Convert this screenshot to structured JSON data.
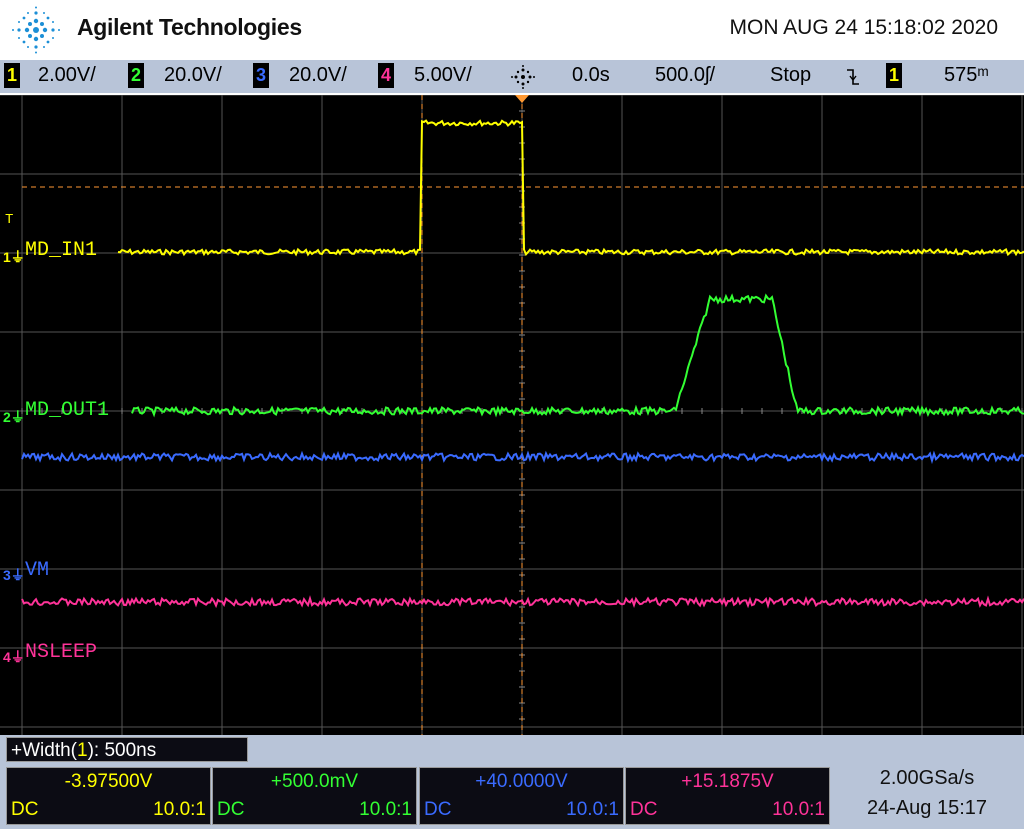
{
  "header": {
    "brand": "Agilent Technologies",
    "datetime": "MON AUG 24 15:18:02 2020"
  },
  "status_bar": {
    "ch1": {
      "num": "1",
      "scale": "2.00V/",
      "color": "#ffff00"
    },
    "ch2": {
      "num": "2",
      "scale": "20.0V/",
      "color": "#33ff33"
    },
    "ch3": {
      "num": "3",
      "scale": "20.0V/",
      "color": "#3a6bff"
    },
    "ch4": {
      "num": "4",
      "scale": "5.00V/",
      "color": "#ff3399"
    },
    "trigger_position": "0.0s",
    "timebase": "500.0ʃ/",
    "run_state": "Stop",
    "trigger_slope_icon": "falling-edge-icon",
    "trigger_source": "1",
    "trigger_level": "575ᵐ"
  },
  "channels": {
    "ch1_label": "MD_IN1",
    "ch2_label": "MD_OUT1",
    "ch3_label": "VM",
    "ch4_label": "NSLEEP",
    "trigger_marker": "T"
  },
  "measurement": {
    "label_pre": "+Width(",
    "label_ch": "1",
    "label_post": "): 500ns"
  },
  "bottom": {
    "ch1": {
      "value": "-3.97500V",
      "coupling": "DC",
      "probe": "10.0:1"
    },
    "ch2": {
      "value": "+500.0mV",
      "coupling": "DC",
      "probe": "10.0:1"
    },
    "ch3": {
      "value": "+40.0000V",
      "coupling": "DC",
      "probe": "10.0:1"
    },
    "ch4": {
      "value": "+15.1875V",
      "coupling": "DC",
      "probe": "10.0:1"
    },
    "sample_rate": "2.00GSa/s",
    "capture_date": "24-Aug 15:17"
  },
  "colors": {
    "ch1": "#ffff00",
    "ch2": "#33ff33",
    "ch3": "#3a6bff",
    "ch4": "#ff3399",
    "grid": "#555555",
    "cursor": "#ff9933"
  }
}
